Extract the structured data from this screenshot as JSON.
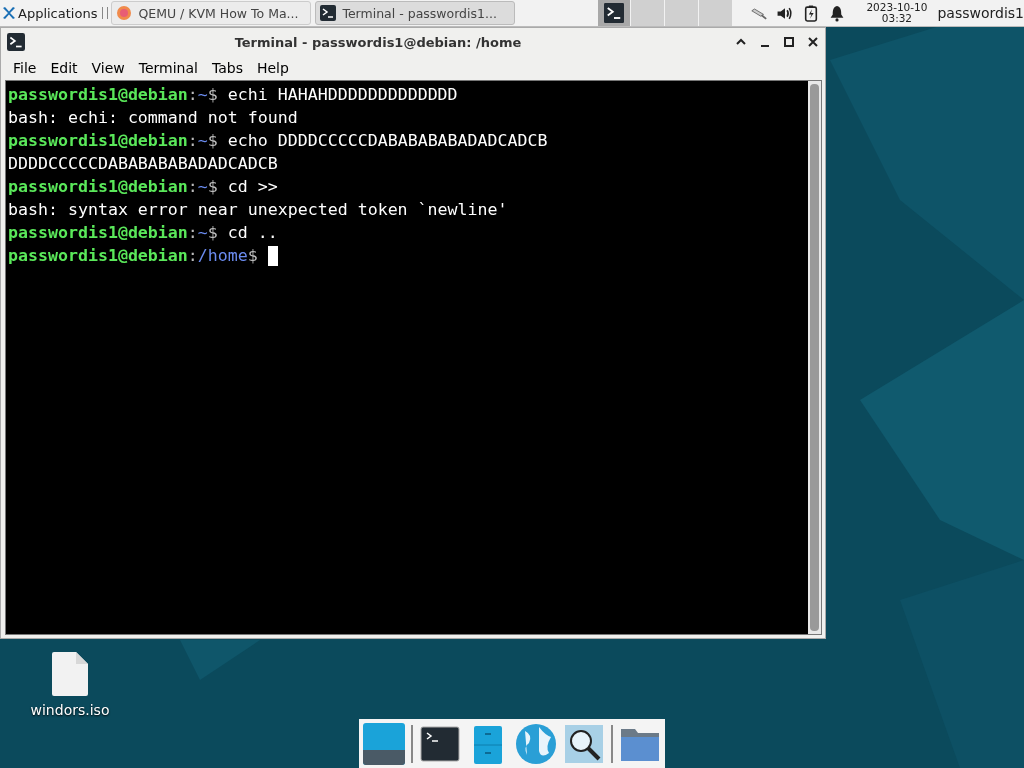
{
  "panel": {
    "apps_menu": "Applications",
    "tasks": [
      {
        "title": "QEMU / KVM How To Ma...",
        "kind": "browser",
        "selected": false
      },
      {
        "title": "Terminal - passwordis1...",
        "kind": "terminal",
        "selected": true
      }
    ],
    "workspaces": [
      {
        "selected": true
      },
      {
        "selected": false
      },
      {
        "selected": false
      },
      {
        "selected": false
      }
    ],
    "date": "2023-10-10",
    "time": "03:32",
    "user": "passwordis1"
  },
  "window": {
    "title": "Terminal - passwordis1@debian: /home",
    "menu": [
      "File",
      "Edit",
      "View",
      "Terminal",
      "Tabs",
      "Help"
    ],
    "lines": [
      {
        "kind": "prompt",
        "user": "passwordis1@debian",
        "colon": ":",
        "path": "~",
        "sign": "$",
        "command": "echi HAHAHDDDDDDDDDDDDD",
        "cursor": false
      },
      {
        "kind": "output",
        "text": "bash: echi: command not found"
      },
      {
        "kind": "prompt",
        "user": "passwordis1@debian",
        "colon": ":",
        "path": "~",
        "sign": "$",
        "command": "echo DDDDCCCCCDABABABABADADCADCB",
        "cursor": false
      },
      {
        "kind": "output",
        "text": "DDDDCCCCCDABABABABADADCADCB"
      },
      {
        "kind": "prompt",
        "user": "passwordis1@debian",
        "colon": ":",
        "path": "~",
        "sign": "$",
        "command": "cd >>",
        "cursor": false
      },
      {
        "kind": "output",
        "text": "bash: syntax error near unexpected token `newline'"
      },
      {
        "kind": "prompt",
        "user": "passwordis1@debian",
        "colon": ":",
        "path": "~",
        "sign": "$",
        "command": "cd ..",
        "cursor": false
      },
      {
        "kind": "prompt",
        "user": "passwordis1@debian",
        "colon": ":",
        "path": "/home",
        "sign": "$",
        "cursor": true
      }
    ]
  },
  "desktop_icons": [
    {
      "label": "windors.iso"
    }
  ],
  "dock": [
    {
      "kind": "desktop"
    },
    {
      "kind": "separator"
    },
    {
      "kind": "terminal"
    },
    {
      "kind": "files"
    },
    {
      "kind": "web"
    },
    {
      "kind": "search"
    },
    {
      "kind": "separator"
    },
    {
      "kind": "folder"
    }
  ]
}
